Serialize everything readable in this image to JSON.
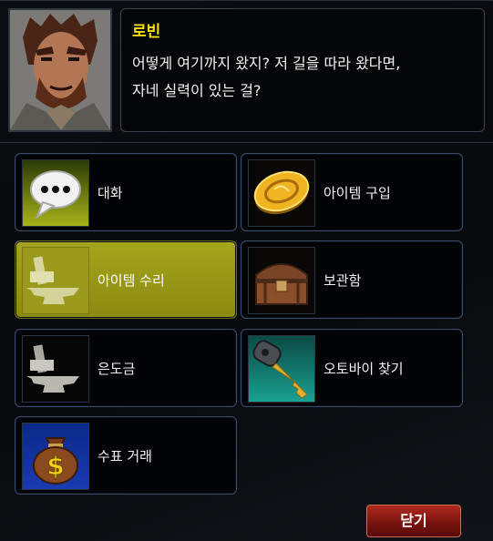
{
  "npc": {
    "name": "로빈",
    "dialog_lines": [
      "어떻게 여기까지 왔지? 저 길을 따라 왔다면,",
      "자네 실력이 있는 걸?"
    ]
  },
  "menu": [
    {
      "label": "대화",
      "icon": "speech-bubble-icon"
    },
    {
      "label": "아이템 구입",
      "icon": "gold-coin-icon"
    },
    {
      "label": "아이템 수리",
      "icon": "anvil-hammer-icon",
      "selected": true
    },
    {
      "label": "보관함",
      "icon": "treasure-chest-icon"
    },
    {
      "label": "은도금",
      "icon": "silver-anvil-icon"
    },
    {
      "label": "오토바이 찾기",
      "icon": "motorcycle-key-icon"
    },
    {
      "label": "수표 거래",
      "icon": "money-bag-icon"
    }
  ],
  "close_label": "닫기",
  "colors": {
    "speaker": "#f4e000",
    "selected_bg": "#a6a41c",
    "button_border": "#3a4a6a",
    "close_red": "#b02a1e"
  }
}
